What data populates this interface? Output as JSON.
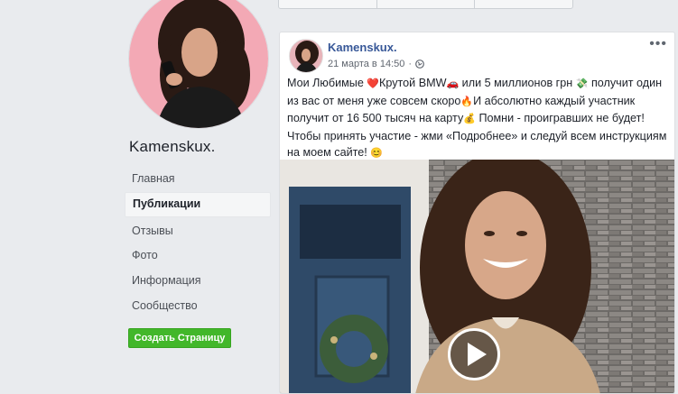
{
  "page": {
    "name": "Kamenskux."
  },
  "nav": {
    "items": [
      {
        "label": "Главная"
      },
      {
        "label": "Публикации"
      },
      {
        "label": "Отзывы"
      },
      {
        "label": "Фото"
      },
      {
        "label": "Информация"
      },
      {
        "label": "Сообщество"
      }
    ],
    "active": "Публикации"
  },
  "create_button": {
    "label": "Создать Страницу"
  },
  "post": {
    "author": "Kamenskux.",
    "timestamp": "21 марта в 14:50",
    "more": "•••",
    "text": {
      "p1": "Мои Любимые ",
      "heart": "❤️",
      "p2": "Крутой BMW",
      "car": "🚗",
      "p3": " или 5 миллионов грн ",
      "money": "💸",
      "p4": " получит один из вас от меня уже совсем скоро",
      "fire": "🔥",
      "p5": "И абсолютно каждый участник получит от 16 500 тысяч на карту",
      "bag": "💰",
      "p6": " Помни - проигравших не будет! Чтобы принять участие - жми «Подробнее» и следуй всем инструкциям на моем сайте! ",
      "smile": "😊"
    }
  },
  "colors": {
    "background": "#e9ebee",
    "link": "#385898",
    "create_button": "#42b72a"
  },
  "icons": [
    "globe-icon",
    "more-icon",
    "play-icon"
  ]
}
